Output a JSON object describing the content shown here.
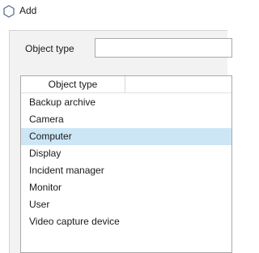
{
  "window": {
    "title": "Add",
    "icon": "hexagon-outline-icon"
  },
  "form": {
    "object_type_label": "Object type",
    "object_type_value": ""
  },
  "list": {
    "column_header": "Object type",
    "items": [
      {
        "label": "Backup archive",
        "selected": false
      },
      {
        "label": "Camera",
        "selected": false
      },
      {
        "label": "Computer",
        "selected": true
      },
      {
        "label": "Display",
        "selected": false
      },
      {
        "label": "Incident manager",
        "selected": false
      },
      {
        "label": "Monitor",
        "selected": false
      },
      {
        "label": "User",
        "selected": false
      },
      {
        "label": "Video capture device",
        "selected": false
      }
    ]
  },
  "colors": {
    "selection": "#cce6f6",
    "icon_stroke": "#5a6f8f",
    "border": "#a9a9a9"
  }
}
